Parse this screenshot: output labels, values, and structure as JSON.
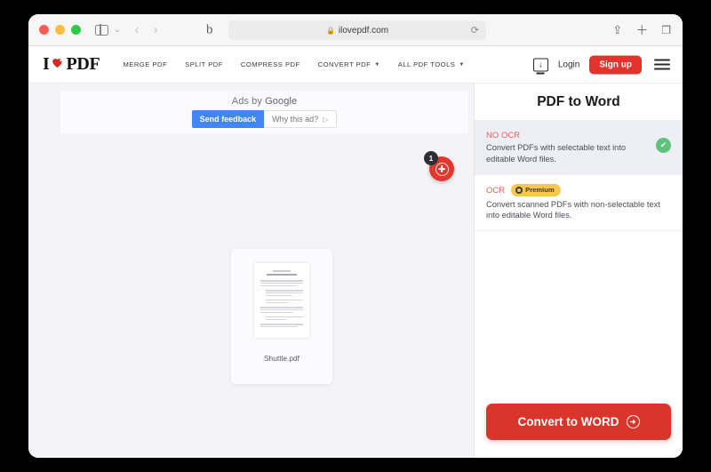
{
  "browser": {
    "url": "ilovepdf.com",
    "lock_icon": "lock-icon",
    "reload_icon": "reload-icon",
    "share_icon": "share-icon",
    "newtab_icon": "plus-icon",
    "tabs_icon": "tabs-icon",
    "back_icon": "chevron-left-icon",
    "forward_icon": "chevron-right-icon",
    "extension_glyph": "b"
  },
  "site": {
    "logo": {
      "i": "I",
      "pdf": "PDF",
      "heart_icon": "heart-icon"
    },
    "nav": [
      {
        "label": "MERGE PDF",
        "has_caret": false
      },
      {
        "label": "SPLIT PDF",
        "has_caret": false
      },
      {
        "label": "COMPRESS PDF",
        "has_caret": false
      },
      {
        "label": "CONVERT PDF",
        "has_caret": true
      },
      {
        "label": "ALL PDF TOOLS",
        "has_caret": true
      }
    ],
    "desktop_icon": "desktop-download-icon",
    "login_label": "Login",
    "signup_label": "Sign up",
    "menu_icon": "hamburger-menu-icon"
  },
  "workspace": {
    "back_icon": "back-arrow-icon",
    "ad": {
      "label_prefix": "Ads by ",
      "label_brand": "Google",
      "send_feedback_label": "Send feedback",
      "why_this_ad_label": "Why this ad?",
      "why_icon": "play-triangle-icon"
    },
    "file": {
      "name": "Shuttle.pdf",
      "thumbnail_icon": "pdf-page-thumbnail"
    },
    "add_file": {
      "icon": "plus-circle-icon",
      "badge_count": "1"
    }
  },
  "sidebar": {
    "title": "PDF to Word",
    "options": [
      {
        "label": "NO OCR",
        "description": "Convert PDFs with selectable text into editable Word files.",
        "selected": true,
        "premium": false,
        "check_icon": "check-circle-icon"
      },
      {
        "label": "OCR",
        "description": "Convert scanned PDFs with non-selectable text into editable Word files.",
        "selected": false,
        "premium": true,
        "premium_label": "Premium",
        "premium_icon": "premium-badge-icon"
      }
    ],
    "action": {
      "label": "Convert to WORD",
      "icon": "arrow-right-circle-icon"
    }
  },
  "colors": {
    "brand_red": "#e5322d",
    "action_red": "#d9352b",
    "accent_blue": "#4285f4",
    "premium_yellow": "#f7c752",
    "success_green": "#5ec27a",
    "workspace_bg": "#f4f4f8"
  }
}
